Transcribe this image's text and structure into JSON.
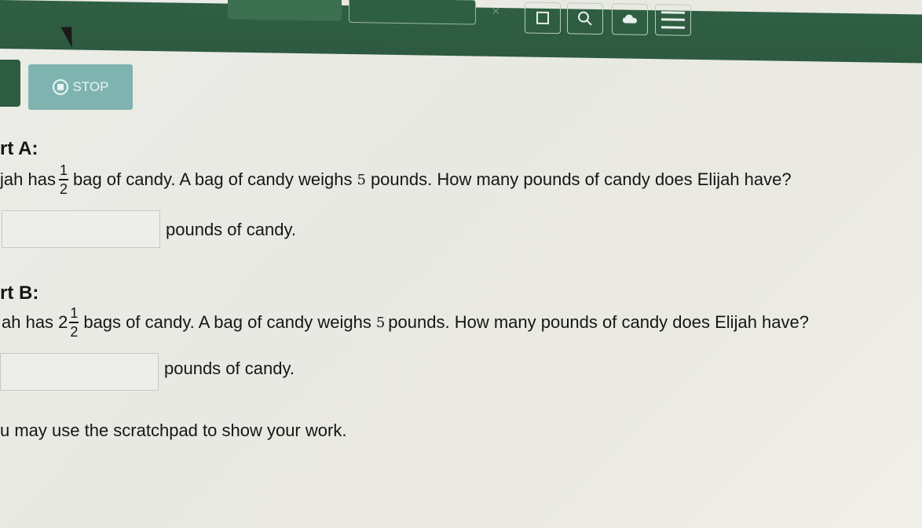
{
  "toolbar": {
    "close_glyph": "×"
  },
  "stop_button": {
    "label": "STOP"
  },
  "part_a": {
    "title": "rt A:",
    "prefix": "jah has",
    "numerator": "1",
    "denominator": "2",
    "text_1": "bag of candy.  A bag of candy weighs",
    "weight": "5",
    "text_2": "pounds.  How many pounds of candy does Elijah have?",
    "answer_value": "",
    "unit": "pounds of candy."
  },
  "part_b": {
    "title": "rt B:",
    "prefix": "ah has",
    "whole": "2",
    "numerator": "1",
    "denominator": "2",
    "text_1": "bags of candy.  A bag of candy weighs",
    "weight": "5",
    "text_2": " pounds.  How many pounds of candy does Elijah have?",
    "answer_value": "",
    "unit": "pounds of candy."
  },
  "note": "u may use the scratchpad to show your work."
}
